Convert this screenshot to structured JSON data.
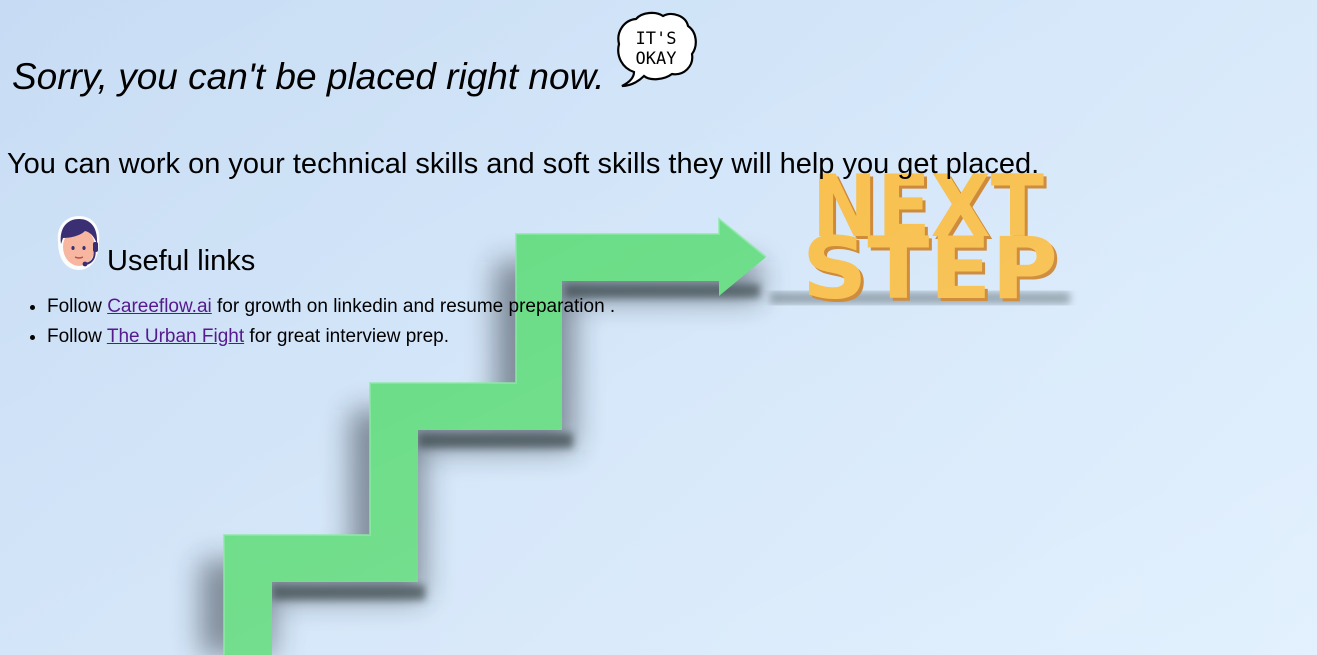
{
  "colors": {
    "background": "#cfe3f8",
    "arrow": "#5bd97a",
    "next_step_text": "#f7b93a",
    "link": "#551a8b"
  },
  "page": {
    "headline": "Sorry, you can't be placed right now.",
    "bubble_text": [
      "IT'S",
      "OKAY"
    ],
    "subline": "You can work on your technical skills and soft skills they will help you get placed.",
    "links_heading": "Useful links"
  },
  "background_art": {
    "icon": "next-step-staircase-arrow",
    "lines": [
      "NEXT",
      "STEP"
    ]
  },
  "links": [
    {
      "prefix": "Follow ",
      "link_text": "Careeflow.ai",
      "suffix": " for growth on linkedin and resume preparation ."
    },
    {
      "prefix": "Follow ",
      "link_text": "The Urban Fight",
      "suffix": " for great interview prep."
    }
  ]
}
